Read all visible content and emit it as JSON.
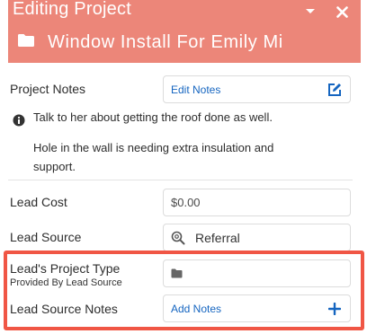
{
  "header": {
    "title": "Editing Project",
    "project_name": "Window Install For Emily Mi"
  },
  "project_notes": {
    "label": "Project Notes",
    "link": "Edit Notes",
    "lines": [
      "Talk to her about getting the roof done as well.",
      "Hole in the wall is needing extra insulation and",
      "support."
    ]
  },
  "lead_cost": {
    "label": "Lead Cost",
    "value": "$0.00"
  },
  "lead_source": {
    "label": "Lead Source",
    "value": "Referral"
  },
  "leads_project_type": {
    "label": "Lead's Project Type",
    "sublabel": "Provided By Lead Source",
    "value": ""
  },
  "lead_source_notes": {
    "label": "Lead Source Notes",
    "link": "Add Notes"
  },
  "colors": {
    "header": "#ec8679",
    "link": "#1565c0",
    "highlight": "#f05645"
  }
}
